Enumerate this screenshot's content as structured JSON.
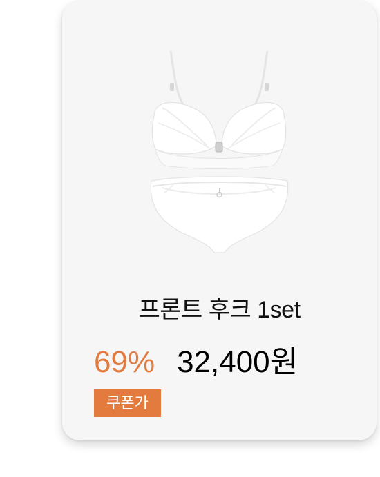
{
  "product": {
    "title": "프론트 후크 1set",
    "discount": "69%",
    "price": "32,400원",
    "badge": "쿠폰가",
    "image_icon": "lingerie-set-icon"
  },
  "colors": {
    "accent": "#e37a3e",
    "card_background": "#f6f6f6",
    "text": "#111111"
  }
}
